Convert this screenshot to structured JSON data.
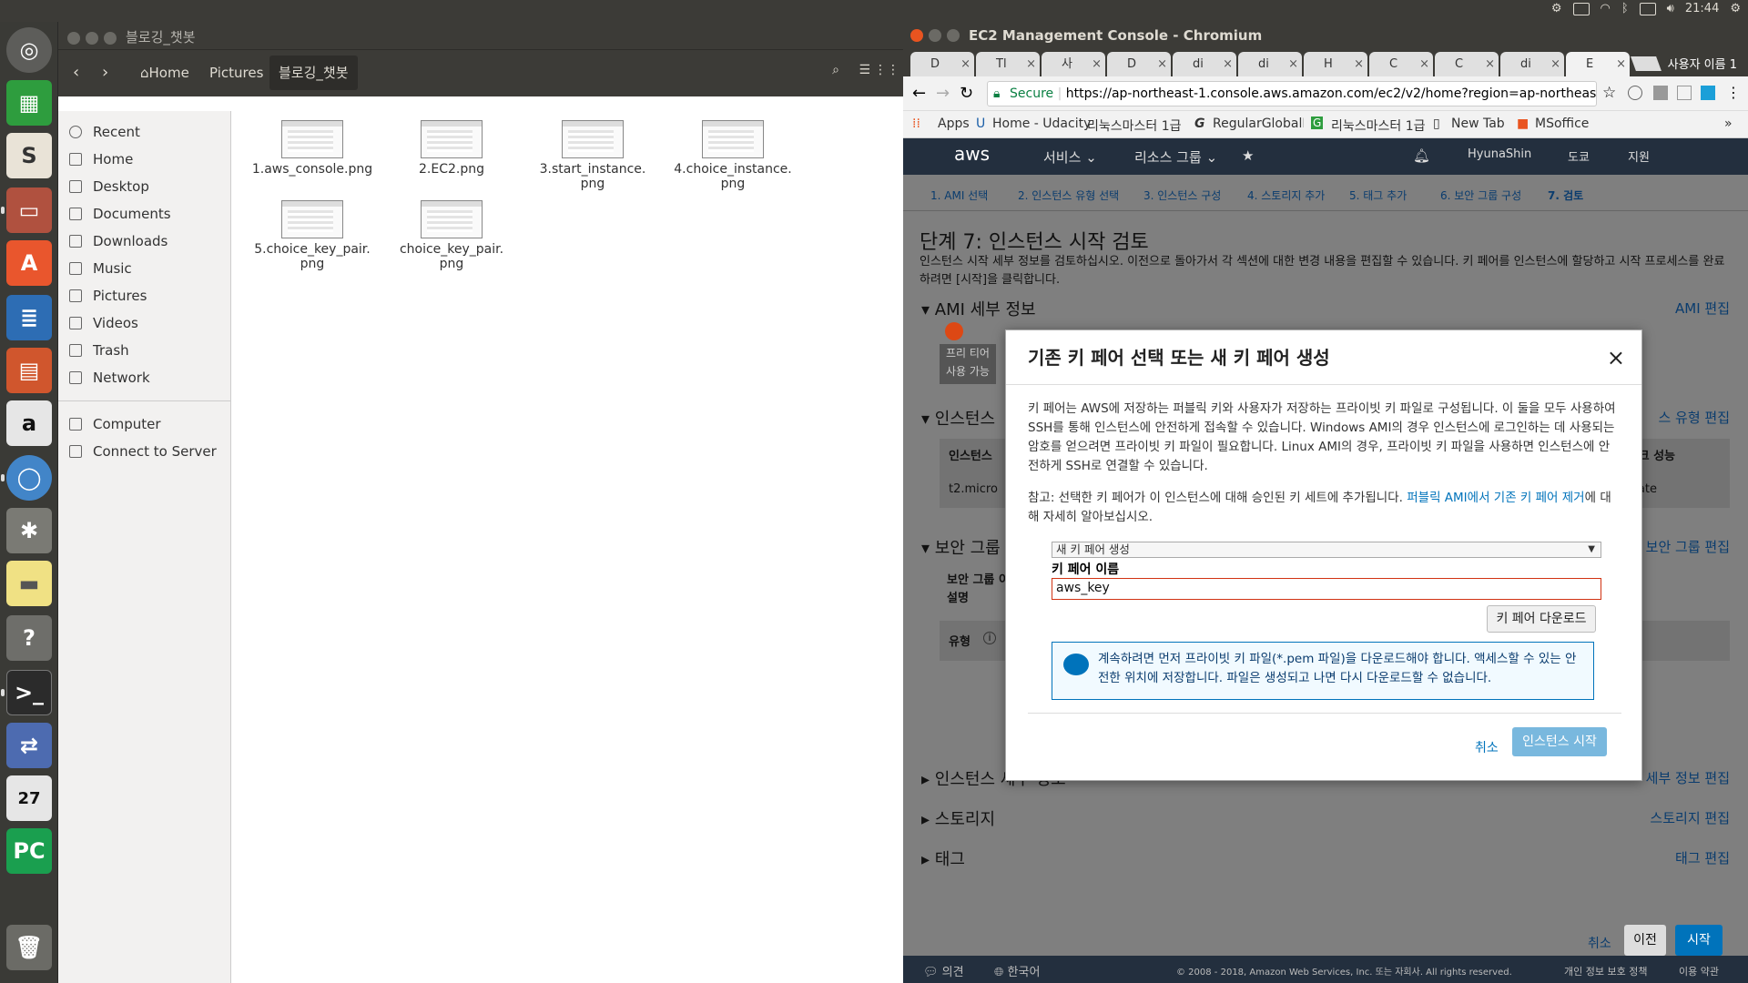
{
  "topbar": {
    "time": "21:44"
  },
  "files": {
    "title": "블로깅_챗봇",
    "crumbs": [
      "Home",
      "Pictures",
      "블로깅_챗봇"
    ],
    "sidebar": [
      "Recent",
      "Home",
      "Desktop",
      "Documents",
      "Downloads",
      "Music",
      "Pictures",
      "Videos",
      "Trash",
      "Network",
      "Computer",
      "Connect to Server"
    ],
    "items": [
      "1.aws_console.png",
      "2.EC2.png",
      "3.start_instance.\npng",
      "4.choice_instance.\npng",
      "5.choice_key_pair.\npng",
      "choice_key_pair.\npng"
    ]
  },
  "chrome": {
    "title": "EC2 Management Console - Chromium",
    "tabs": [
      "D",
      "Tl",
      "사",
      "D",
      "di",
      "di",
      "H",
      "C",
      "C",
      "di",
      "E"
    ],
    "user": "사용자 이름 1",
    "secure": "Secure",
    "url": "https://ap-northeast-1.console.aws.amazon.com/ec2/v2/home?region=ap-northeast-1...",
    "bookmarks": [
      "Apps",
      "Home - Udacity",
      "리눅스마스터 1급",
      "RegularGlobalM",
      "리눅스마스터 1급",
      "New Tab",
      "MSoffice"
    ]
  },
  "aws": {
    "logo": "aws",
    "services": "서비스",
    "groups": "리소스 그룹",
    "user": "HyunaShin",
    "region": "도쿄",
    "support": "지원",
    "steps": [
      "1. AMI 선택",
      "2. 인스턴스 유형 선택",
      "3. 인스턴스 구성",
      "4. 스토리지 추가",
      "5. 태그 추가",
      "6. 보안 그룹 구성",
      "7. 검토"
    ],
    "heading": "단계 7: 인스턴스 시작 검토",
    "desc": "인스턴스 시작 세부 정보를 검토하십시오. 이전으로 돌아가서 각 섹션에 대한 변경 내용을 편집할 수 있습니다. 키 페어를 인스턴스에 할당하고 시작 프로세스를 완료하려면 [시작]을 클릭합니다.",
    "sections": [
      "AMI 세부 정보",
      "인스턴스",
      "보안 그룹",
      "인스턴스 세부 정보",
      "스토리지",
      "태그"
    ],
    "edits": [
      "AMI 편집",
      "스 유형 편집",
      "보안 그룹 편집",
      "세부 정보 편집",
      "스토리지 편집",
      "태그 편집"
    ],
    "free_tier": "프리 티어\n사용 가능",
    "col": "인스턴스",
    "col2": "워크 성능",
    "cell": "t2.micro",
    "cell2": "o Moderate",
    "sg_label": "보안 그룹 이\n설명",
    "type_label": "유형",
    "cancel": "취소",
    "prev": "이전",
    "launch": "시작",
    "footer": [
      "의견",
      "한국어",
      "© 2008 - 2018, Amazon Web Services, Inc. 또는 자회사. All rights reserved.",
      "개인 정보 보호 정책",
      "이용 약관"
    ]
  },
  "modal": {
    "title": "기존 키 페어 선택 또는 새 키 페어 생성",
    "close": "×",
    "p1": "키 페어는 AWS에 저장하는 퍼블릭 키와 사용자가 저장하는 프라이빗 키 파일로 구성됩니다. 이 둘을 모두 사용하여 SSH를 통해 인스턴스에 안전하게 접속할 수 있습니다. Windows AMI의 경우 인스턴스에 로그인하는 데 사용되는 암호를 얻으려면 프라이빗 키 파일이 필요합니다. Linux AMI의 경우, 프라이빗 키 파일을 사용하면 인스턴스에 안전하게 SSH로 연결할 수 있습니다.",
    "p2a": "참고: 선택한 키 페어가 이 인스턴스에 대해 승인된 키 세트에 추가됩니다. ",
    "p2link": "퍼블릭 AMI에서 기존 키 페어 제거",
    "p2b": "에 대해 자세히 알아보십시오.",
    "select": "새 키 페어 생성",
    "label": "키 페어 이름",
    "value": "aws_key",
    "download": "키 페어 다운로드",
    "info": "계속하려면 먼저 프라이빗 키 파일(*.pem 파일)을 다운로드해야 합니다. 액세스할 수 있는 안전한 위치에 저장합니다. 파일은 생성되고 나면 다시 다운로드할 수 없습니다.",
    "cancel": "취소",
    "launch": "인스턴스 시작"
  }
}
